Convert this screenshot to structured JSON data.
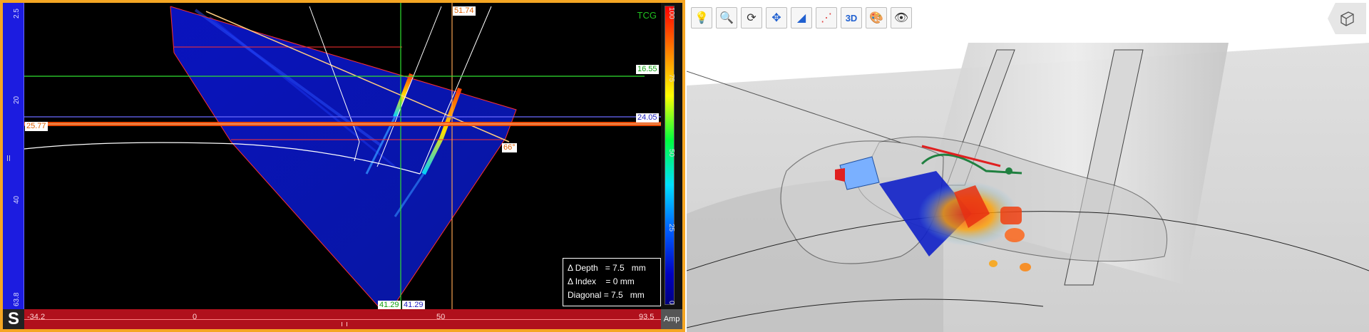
{
  "sscan": {
    "tcg_label": "TCG",
    "cursor_top_value": "51.74",
    "hline_green_value": "16.55",
    "hline_blue_value": "24.05",
    "hline_red_value": "25.77",
    "angle_value": "66°",
    "cursor_bottom_green": "41.29",
    "cursor_bottom_blue": "41.29",
    "vertical_ruler_ticks": [
      "2.5",
      "20",
      "40",
      "63.8"
    ],
    "horizontal_ruler_ticks": [
      "-34.2",
      "0",
      "50",
      "93.5"
    ],
    "colorbar_ticks": [
      "100",
      "75",
      "50",
      "25",
      "0"
    ],
    "amp_label": "Amp",
    "s_badge": "S",
    "measure": {
      "depth": "Δ Depth   = 7.5   mm",
      "index": "Δ Index    = 0 mm",
      "diagonal": "Diagonal = 7.5   mm"
    }
  },
  "toolbar": {
    "buttons": [
      {
        "name": "light-bulb-icon"
      },
      {
        "name": "zoom-icon"
      },
      {
        "name": "rotate-icon"
      },
      {
        "name": "pan-icon"
      },
      {
        "name": "probe-icon"
      },
      {
        "name": "beam-icon"
      },
      {
        "name": "3d-icon",
        "label": "3D"
      },
      {
        "name": "palette-icon"
      },
      {
        "name": "eye-icon"
      }
    ]
  },
  "colors": {
    "frame": "#f5a623",
    "ruler_blue": "#1c1ce0",
    "ruler_red": "#b0101c",
    "green_line": "#30e030",
    "orange_line": "#f5a050",
    "red_line": "#ff3030"
  }
}
